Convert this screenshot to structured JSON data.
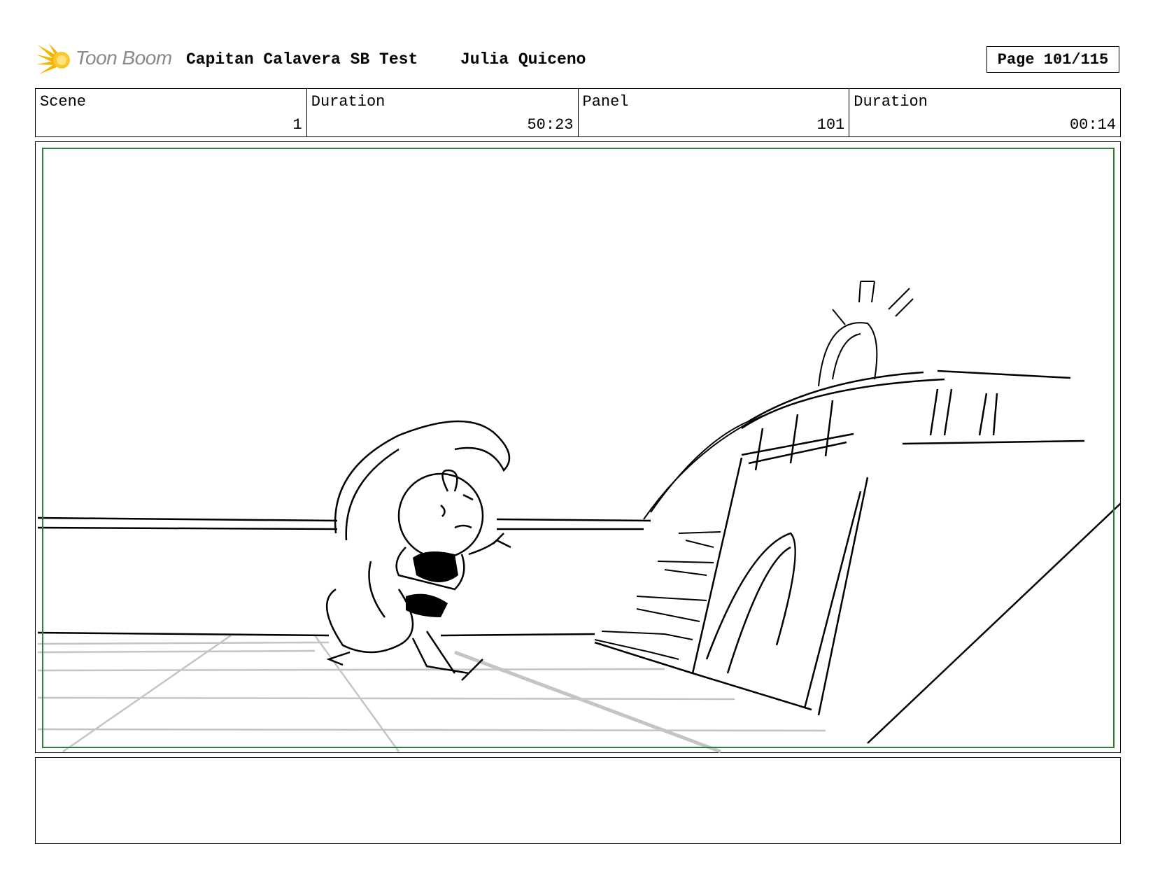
{
  "header": {
    "logo_text": "Toon Boom",
    "title": "Capitan Calavera SB Test",
    "author": "Julia Quiceno",
    "page": "Page 101/115"
  },
  "info": {
    "scene_label": "Scene",
    "scene_value": "1",
    "scene_duration_label": "Duration",
    "scene_duration_value": "50:23",
    "panel_label": "Panel",
    "panel_value": "101",
    "panel_duration_label": "Duration",
    "panel_duration_value": "00:14"
  },
  "panel": {
    "safe_area_color": "#2e7d32",
    "sketch": "storyboard drawing: character running on ship deck toward stairs and helm"
  },
  "notes": {
    "text": ""
  }
}
